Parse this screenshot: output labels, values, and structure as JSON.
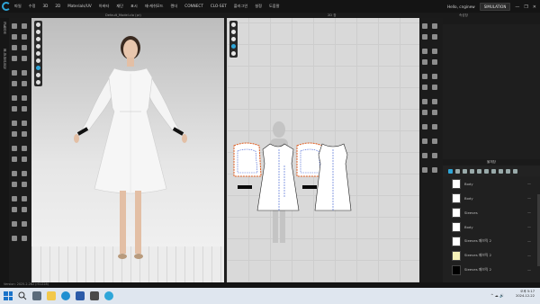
{
  "menubar": {
    "items": [
      "파일",
      "수정",
      "3D",
      "2D",
      "Materials/UV",
      "아바타",
      "재단",
      "표시",
      "재-캐쉬모드",
      "렌더",
      "CONNECT",
      "CLO-SET",
      "플러그인",
      "설정",
      "도움말"
    ],
    "user": "Hello, cnginew",
    "simulation_label": "SIMULATION",
    "window_controls": [
      "—",
      "❐",
      "✕"
    ]
  },
  "titles": {
    "avatar_window": "Default_Model.clo (pr)",
    "pattern_window": "2D 창",
    "right_top": "속성창",
    "fabric_panel": "물체창"
  },
  "sidebar": {
    "tabs": [
      "오브젝트",
      "라이브러리 창"
    ]
  },
  "fabric": {
    "add_label": "+ 추가",
    "items": [
      {
        "name": "Body",
        "swatch": "#ffffff"
      },
      {
        "name": "Body",
        "swatch": "#ffffff"
      },
      {
        "name": "Sleeves",
        "swatch": "#ffffff"
      },
      {
        "name": "Body",
        "swatch": "#ffffff"
      },
      {
        "name": "Sleeves 패브릭 2",
        "swatch": "#ffffff"
      },
      {
        "name": "Sleeves 패브릭 2",
        "swatch": "#f5f1b8"
      },
      {
        "name": "Sleeves 패브릭 2",
        "swatch": "#000000"
      }
    ]
  },
  "status": {
    "version": "Version: 2025.2.282 (r51228)"
  },
  "taskbar": {
    "time": "오후 5:17",
    "date": "2024-12-22"
  },
  "colors": {
    "accent": "#2ea6d9",
    "pattern_edge": "#e05a1b",
    "pattern_seam": "#3b5bd1"
  },
  "icons": [
    "search-icon",
    "windows-start-icon",
    "folder-icon",
    "edge-icon",
    "gear-icon",
    "plus-icon"
  ]
}
